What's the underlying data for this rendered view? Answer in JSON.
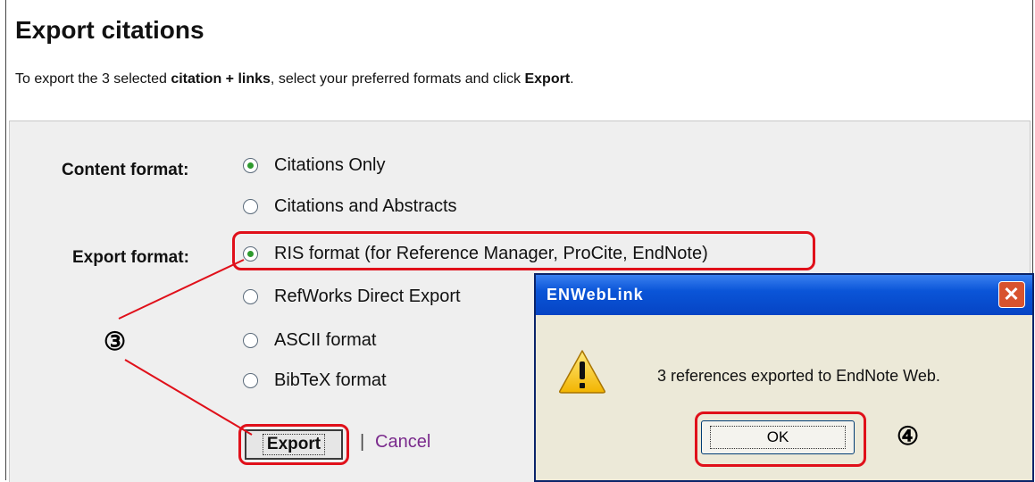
{
  "page": {
    "title": "Export citations",
    "intro_prefix": "To export the 3 selected ",
    "intro_bold1": "citation + links",
    "intro_mid": ", select your preferred formats and click ",
    "intro_bold2": "Export",
    "intro_end": "."
  },
  "form": {
    "content_label": "Content format:",
    "content_options": [
      "Citations Only",
      "Citations and Abstracts"
    ],
    "content_selected": "Citations Only",
    "export_label": "Export format:",
    "export_options": [
      "RIS format (for Reference Manager, ProCite, EndNote)",
      "RefWorks Direct Export",
      "ASCII format",
      "BibTeX format"
    ],
    "export_selected": "RIS format (for Reference Manager, ProCite, EndNote)",
    "export_button": "Export",
    "separator": "|",
    "cancel_link": "Cancel"
  },
  "annotations": {
    "step3": "③",
    "step4": "④",
    "highlight_color": "#e0101a"
  },
  "dialog": {
    "title": "ENWebLink",
    "close_glyph": "✕",
    "icon": "warning-icon",
    "message": "3 references exported to EndNote Web.",
    "ok_label": "OK"
  }
}
